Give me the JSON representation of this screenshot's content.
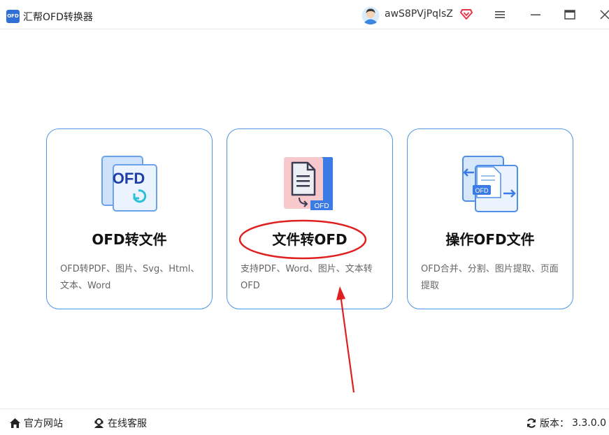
{
  "window": {
    "title": "汇帮OFD转换器",
    "logo_text": "OFD",
    "username": "awS8PVjPqlsZ",
    "cut_text": "汇帮OFD转换器"
  },
  "cards": [
    {
      "title": "OFD转文件",
      "desc": "OFD转PDF、图片、Svg、Html、文本、Word",
      "icon_label": "OFD"
    },
    {
      "title": "文件转OFD",
      "desc": "支持PDF、Word、图片、文本转OFD",
      "icon_label": "OFD"
    },
    {
      "title": "操作OFD文件",
      "desc": "OFD合并、分割、图片提取、页面提取",
      "icon_label": "OFD"
    }
  ],
  "footer": {
    "website": "官方网站",
    "support": "在线客服",
    "version_label": "版本：",
    "version": "3.3.0.0"
  },
  "colors": {
    "accent": "#2f6fd6",
    "card_border": "#4f95e6",
    "annotation_red": "#e02020"
  }
}
